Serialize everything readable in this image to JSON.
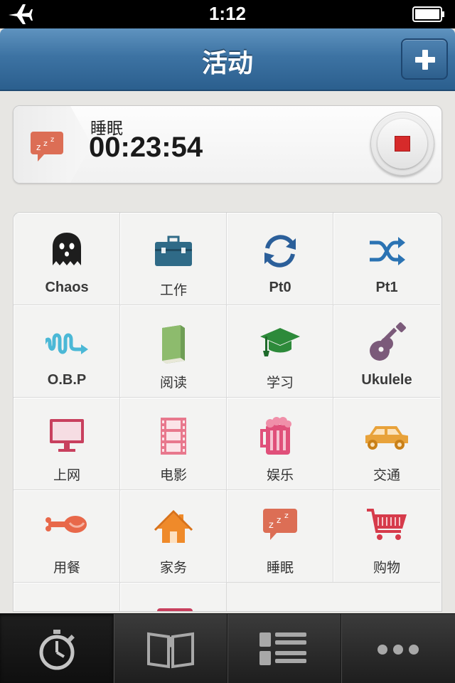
{
  "status_bar": {
    "time": "1:12",
    "airplane_icon": "airplane-icon",
    "battery_icon": "battery-icon"
  },
  "nav": {
    "title": "活动",
    "add_button_icon": "plus-icon"
  },
  "current_activity": {
    "name": "睡眠",
    "elapsed": "00:23:54",
    "icon": "sleep-bubble-icon",
    "stop_button_icon": "stop-icon"
  },
  "activities": [
    {
      "label": "Chaos",
      "icon": "ghost-icon"
    },
    {
      "label": "工作",
      "icon": "toolbox-icon"
    },
    {
      "label": "Pt0",
      "icon": "refresh-icon"
    },
    {
      "label": "Pt1",
      "icon": "shuffle-icon"
    },
    {
      "label": "O.B.P",
      "icon": "squiggle-arrow-icon"
    },
    {
      "label": "阅读",
      "icon": "book-icon"
    },
    {
      "label": "学习",
      "icon": "graduation-cap-icon"
    },
    {
      "label": "Ukulele",
      "icon": "ukulele-icon"
    },
    {
      "label": "上网",
      "icon": "monitor-icon"
    },
    {
      "label": "电影",
      "icon": "film-icon"
    },
    {
      "label": "娱乐",
      "icon": "beer-mug-icon"
    },
    {
      "label": "交通",
      "icon": "car-icon"
    },
    {
      "label": "用餐",
      "icon": "drumstick-icon"
    },
    {
      "label": "家务",
      "icon": "house-icon"
    },
    {
      "label": "睡眠",
      "icon": "sleep-bubble-icon"
    },
    {
      "label": "购物",
      "icon": "shopping-cart-icon"
    }
  ],
  "tab_bar": [
    {
      "icon": "stopwatch-icon",
      "active": true
    },
    {
      "icon": "open-book-icon",
      "active": false
    },
    {
      "icon": "list-icon",
      "active": false
    },
    {
      "icon": "more-dots-icon",
      "active": false
    }
  ],
  "colors": {
    "nav_blue": "#3d73a3",
    "stop_red": "#d62a2a",
    "sleep_orange": "#dc6e55",
    "tab_dark": "#1e1e1e"
  }
}
